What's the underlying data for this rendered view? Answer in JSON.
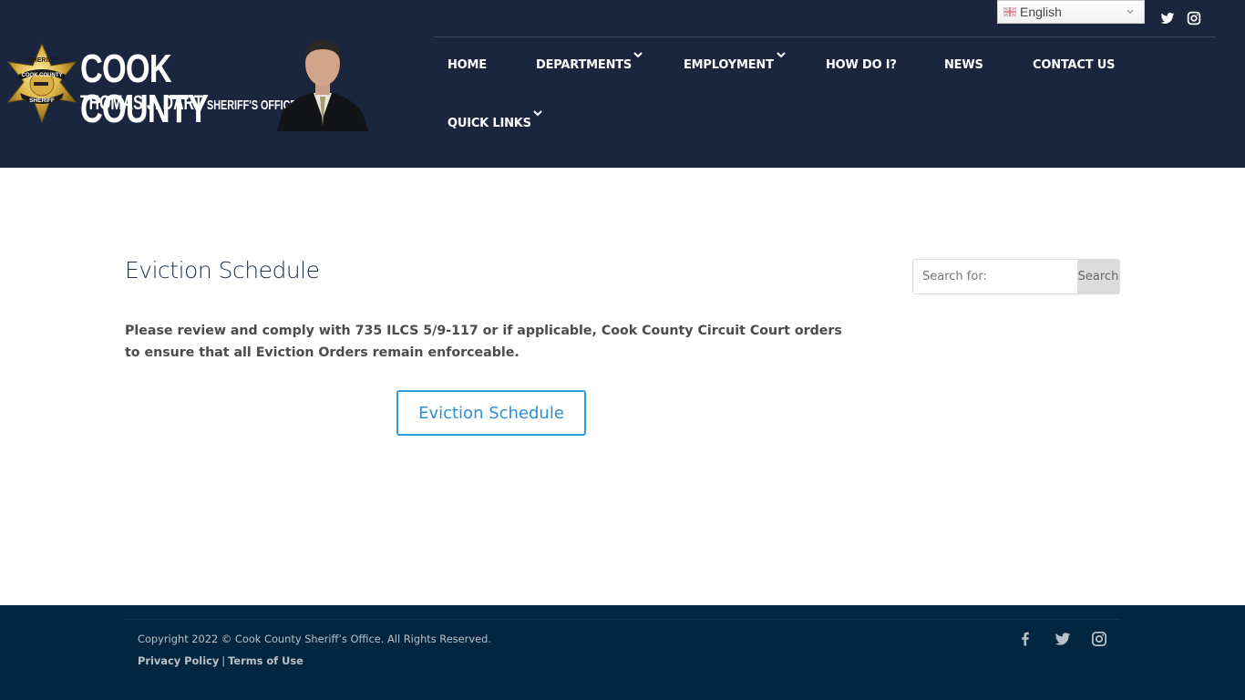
{
  "header": {
    "logo": {
      "title": "COOK COUNTY",
      "name": "THOMAS J. DART",
      "office": "SHERIFF'S OFFICE",
      "badge_top": "SHERIFF",
      "badge_middle": "COOK COUNTY",
      "badge_bottom": "SHERIFF"
    },
    "language": {
      "selected": "English",
      "flag": "uk-flag-icon"
    },
    "top_social": [
      {
        "name": "twitter-icon"
      },
      {
        "name": "instagram-icon"
      }
    ],
    "nav": [
      {
        "label": "HOME",
        "dropdown": false
      },
      {
        "label": "DEPARTMENTS",
        "dropdown": true
      },
      {
        "label": "EMPLOYMENT",
        "dropdown": true
      },
      {
        "label": "HOW DO I?",
        "dropdown": false
      },
      {
        "label": "NEWS",
        "dropdown": false
      },
      {
        "label": "CONTACT US",
        "dropdown": false
      },
      {
        "label": "QUICK LINKS",
        "dropdown": true
      }
    ]
  },
  "main": {
    "title": "Eviction Schedule",
    "intro": "Please review and comply with 735 ILCS 5/9-117 or if applicable, Cook County Circuit Court orders to ensure that all Eviction Orders remain enforceable.",
    "cta_label": "Eviction Schedule"
  },
  "sidebar": {
    "search": {
      "placeholder": "Search for:",
      "value": "",
      "button_label": "Search"
    }
  },
  "footer": {
    "copyright": "Copyright 2022 © Cook County Sheriff’s Office. All Rights Reserved.",
    "links": [
      {
        "label": "Privacy Policy"
      },
      {
        "label": "Terms of Use"
      }
    ],
    "separator": "|",
    "social": [
      {
        "name": "facebook-icon"
      },
      {
        "name": "twitter-icon"
      },
      {
        "name": "instagram-icon"
      }
    ]
  },
  "colors": {
    "header_bg": "#19263e",
    "footer_bg": "#032640",
    "accent": "#2e9fdf",
    "title": "#1c2f4e",
    "body_text": "#4b4b4b"
  }
}
